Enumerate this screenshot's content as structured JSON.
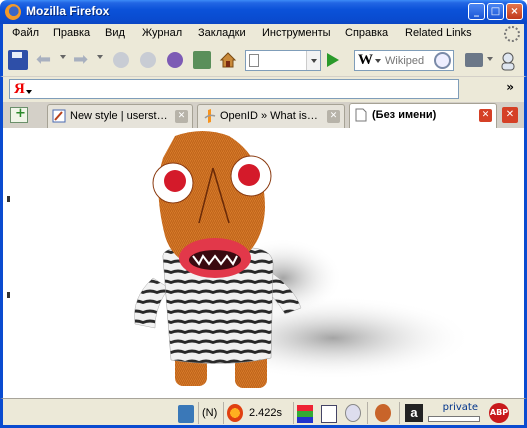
{
  "window": {
    "title": "Mozilla Firefox",
    "minimize_label": "_",
    "maximize_label": "□",
    "close_label": "×"
  },
  "menu": {
    "items": [
      "Файл",
      "Правка",
      "Вид",
      "Журнал",
      "Закладки",
      "Инструменты",
      "Справка",
      "Related Links"
    ]
  },
  "toolbar": {
    "search_engine_label": "W",
    "search_placeholder": "Wikiped"
  },
  "yandex_bar": {
    "logo_text": "Я",
    "overflow_label": "»"
  },
  "tabs": [
    {
      "label": "New style | userst…",
      "active": false
    },
    {
      "label": "OpenID » What is…",
      "active": false
    },
    {
      "label": "(Без имени)",
      "active": true
    }
  ],
  "statusbar": {
    "n_label": "(N)",
    "timer": "2.422s",
    "amazon_label": "a",
    "private_label": "private",
    "abp_label": "ABP"
  },
  "colors": {
    "title_blue": "#0a4bd0",
    "chrome_bg": "#ece9d8",
    "close_red": "#d54026"
  }
}
